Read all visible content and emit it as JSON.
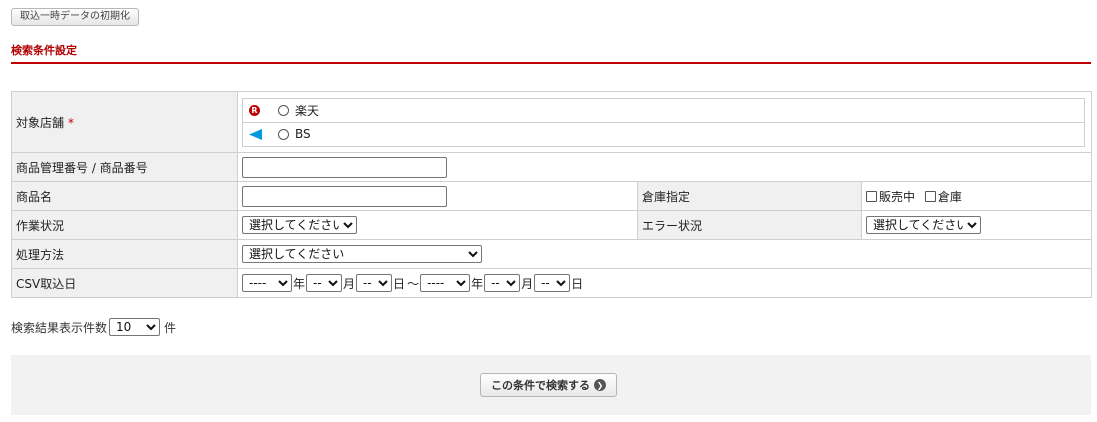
{
  "header": {
    "reset_label": "取込一時データの初期化",
    "section_title": "検索条件設定"
  },
  "form": {
    "shop": {
      "label": "対象店舗",
      "required_mark": "*",
      "options": [
        {
          "label": "楽天",
          "icon": "rakuten-icon",
          "color": "#c00000"
        },
        {
          "label": "BS",
          "icon": "bs-icon",
          "color": "#0099dd"
        }
      ]
    },
    "product_number": {
      "label": "商品管理番号 / 商品番号",
      "value": ""
    },
    "product_name": {
      "label": "商品名",
      "value": ""
    },
    "warehouse": {
      "label": "倉庫指定",
      "options": [
        "販売中",
        "倉庫"
      ]
    },
    "work_status": {
      "label": "作業状況",
      "selected": "選択してください"
    },
    "error_status": {
      "label": "エラー状況",
      "selected": "選択してください"
    },
    "process_method": {
      "label": "処理方法",
      "selected": "選択してください"
    },
    "csv_date": {
      "label": "CSV取込日",
      "from": {
        "year": "----",
        "month": "--",
        "day": "--"
      },
      "to": {
        "year": "----",
        "month": "--",
        "day": "--"
      },
      "year_unit": "年",
      "month_unit": "月",
      "day_unit": "日",
      "range_sep": "〜"
    }
  },
  "per_page": {
    "label": "検索結果表示件数",
    "selected": "10",
    "unit": "件"
  },
  "search": {
    "button_label": "この条件で検索する",
    "accent": "#c00000"
  }
}
